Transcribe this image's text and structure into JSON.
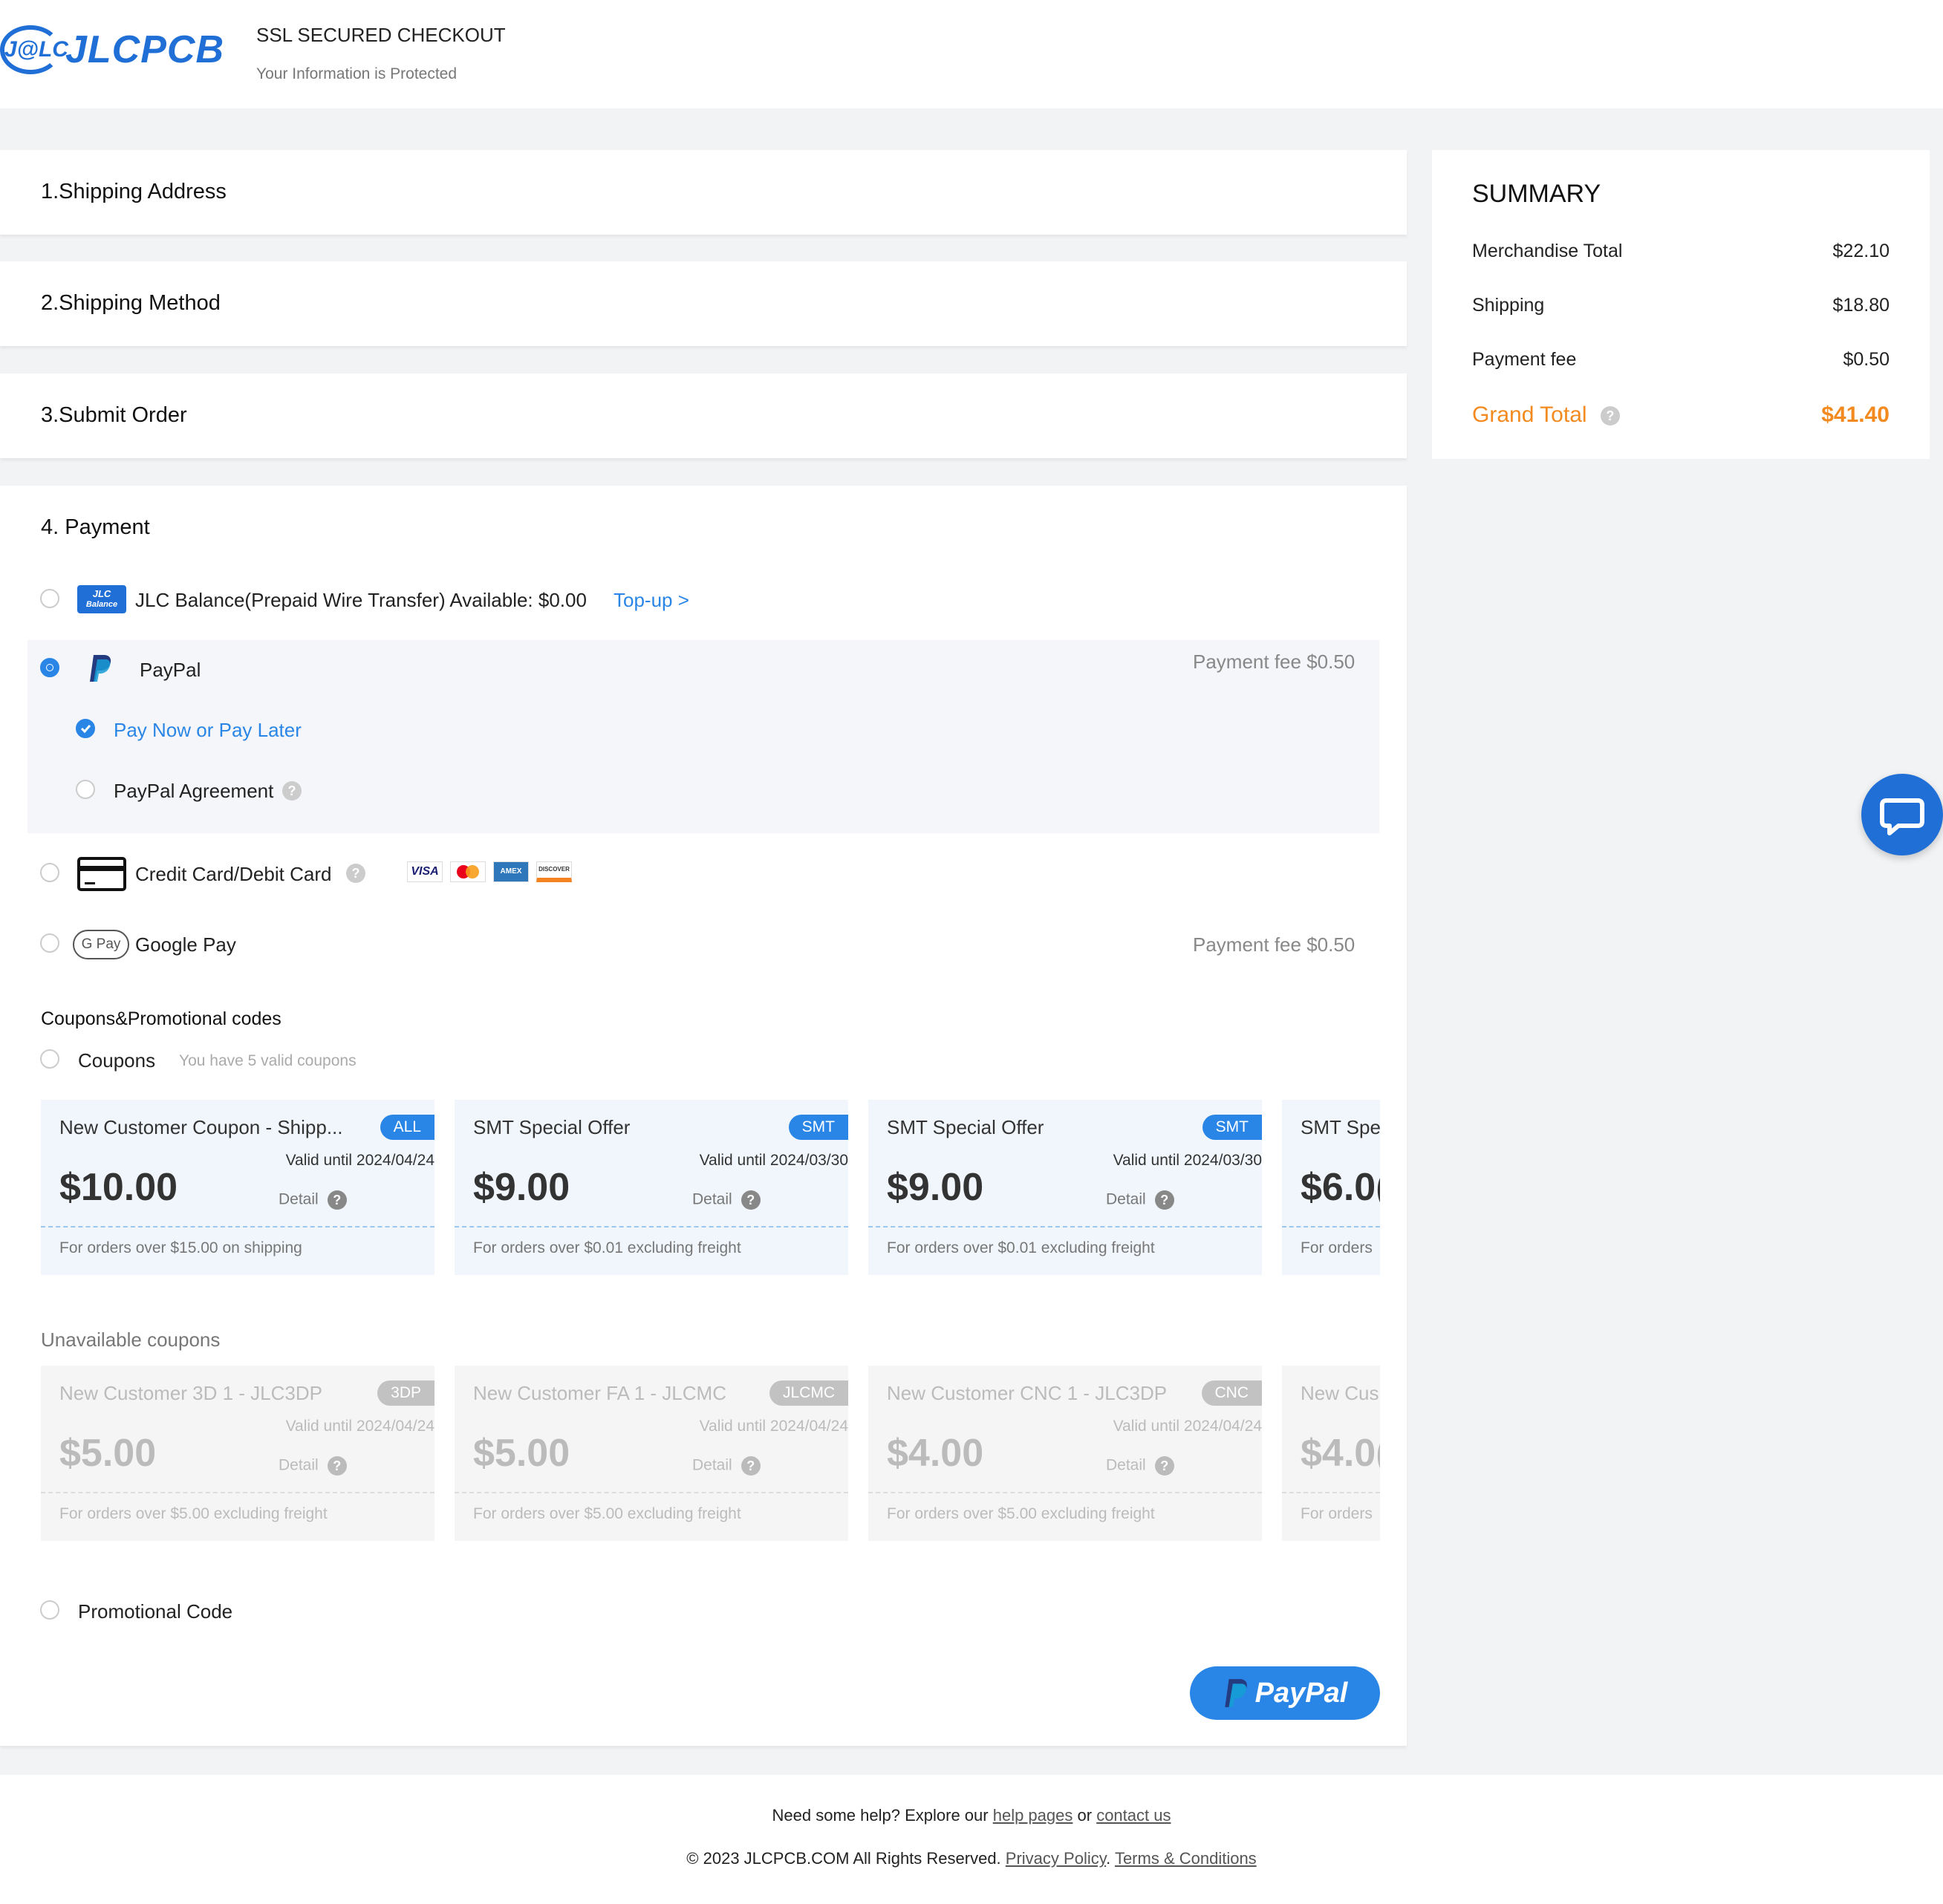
{
  "header": {
    "logo_mark": "J@LC",
    "logo_text": "JLCPCB",
    "ssl_title": "SSL SECURED CHECKOUT",
    "ssl_subtitle": "Your Information is Protected"
  },
  "sections": {
    "shipping_address": "1.Shipping Address",
    "shipping_method": "2.Shipping Method",
    "submit_order": "3.Submit Order",
    "payment": "4. Payment"
  },
  "summary": {
    "title": "SUMMARY",
    "rows": [
      {
        "label": "Merchandise Total",
        "value": "$22.10"
      },
      {
        "label": "Shipping",
        "value": "$18.80"
      },
      {
        "label": "Payment fee",
        "value": "$0.50"
      }
    ],
    "grand_label": "Grand Total",
    "grand_value": "$41.40",
    "accent_color": "#f28a1f"
  },
  "payment": {
    "jlc_balance": {
      "icon_text": "JLC",
      "icon_sub": "Balance",
      "label": "JLC Balance(Prepaid Wire Transfer) Available: $0.00",
      "topup": "Top-up >"
    },
    "paypal": {
      "label": "PayPal",
      "fee": "Payment fee $0.50",
      "option_1": "Pay Now or Pay Later",
      "option_2": "PayPal Agreement"
    },
    "card": {
      "label": "Credit Card/Debit Card",
      "brands": [
        "VISA",
        "MC",
        "AMEX",
        "DISCOVER"
      ]
    },
    "google_pay": {
      "icon_text": "G Pay",
      "label": "Google Pay",
      "fee": "Payment fee $0.50"
    },
    "selected": "paypal",
    "accent_color": "#2a86e6"
  },
  "coupons": {
    "heading": "Coupons&Promotional codes",
    "label": "Coupons",
    "hint": "You have 5 valid coupons",
    "detail_label": "Detail",
    "available": [
      {
        "title": "New Customer Coupon - Shipp...",
        "tag": "ALL",
        "valid": "Valid until 2024/04/24",
        "amount": "$10.00",
        "cond": "For orders over $15.00 on shipping"
      },
      {
        "title": "SMT Special Offer",
        "tag": "SMT",
        "valid": "Valid until 2024/03/30",
        "amount": "$9.00",
        "cond": "For orders over $0.01 excluding freight"
      },
      {
        "title": "SMT Special Offer",
        "tag": "SMT",
        "valid": "Valid until 2024/03/30",
        "amount": "$9.00",
        "cond": "For orders over $0.01 excluding freight"
      },
      {
        "title": "SMT Spe",
        "amount": "$6.0(",
        "cond": "For orders"
      }
    ],
    "unavailable_heading": "Unavailable coupons",
    "unavailable": [
      {
        "title": "New Customer 3D 1 - JLC3DP",
        "tag": "3DP",
        "valid": "Valid until 2024/04/24",
        "amount": "$5.00",
        "cond": "For orders over $5.00 excluding freight"
      },
      {
        "title": "New Customer FA 1 - JLCMC",
        "tag": "JLCMC",
        "valid": "Valid until 2024/04/24",
        "amount": "$5.00",
        "cond": "For orders over $5.00 excluding freight"
      },
      {
        "title": "New Customer CNC 1 - JLC3DP",
        "tag": "CNC",
        "valid": "Valid until 2024/04/24",
        "amount": "$4.00",
        "cond": "For orders over $5.00 excluding freight"
      },
      {
        "title": "New Cus",
        "amount": "$4.0(",
        "cond": "For orders"
      }
    ],
    "promo_label": "Promotional Code"
  },
  "paypal_button": {
    "label": "PayPal"
  },
  "footer": {
    "help_prefix": "Need some help? Explore our",
    "help_link": "help pages",
    "or": "or",
    "contact_link": "contact us",
    "copyright": "© 2023 JLCPCB.COM All Rights Reserved.",
    "privacy": "Privacy Policy",
    "sep": ".",
    "terms": "Terms & Conditions"
  }
}
